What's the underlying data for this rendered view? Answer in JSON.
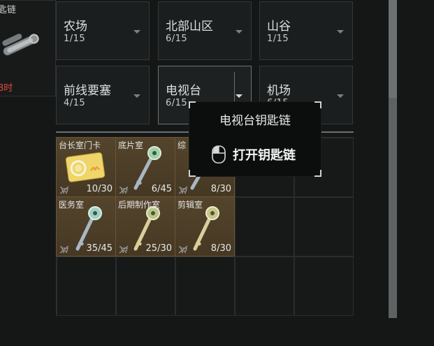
{
  "left_card": {
    "title": "匙链",
    "timer": "8时"
  },
  "maps": [
    {
      "name": "农场",
      "count": "1/15",
      "selected": false
    },
    {
      "name": "北部山区",
      "count": "6/15",
      "selected": false
    },
    {
      "name": "山谷",
      "count": "1/15",
      "selected": false
    },
    {
      "name": "前线要塞",
      "count": "4/15",
      "selected": false
    },
    {
      "name": "电视台",
      "count": "6/15",
      "selected": true
    },
    {
      "name": "机场",
      "count": "6/15",
      "selected": false
    }
  ],
  "items": [
    {
      "label": "台长室门卡",
      "qty": "10/30",
      "icon": "keycard-icon"
    },
    {
      "label": "底片室",
      "qty": "6/45",
      "icon": "key-icon"
    },
    {
      "label": "综",
      "qty": "8/30",
      "icon": "key-icon"
    },
    {
      "label": "医务室",
      "qty": "35/45",
      "icon": "key-icon"
    },
    {
      "label": "后期制作室",
      "qty": "25/30",
      "icon": "key-icon"
    },
    {
      "label": "剪辑室",
      "qty": "8/30",
      "icon": "key-icon"
    }
  ],
  "tooltip": {
    "title": "电视台钥匙链",
    "action_label": "打开钥匙链",
    "action_icon": "mouse-icon"
  },
  "colors": {
    "item_bg": "#4c3e28",
    "tile_bg": "#1b1e1e",
    "timer": "#e04a3a"
  }
}
